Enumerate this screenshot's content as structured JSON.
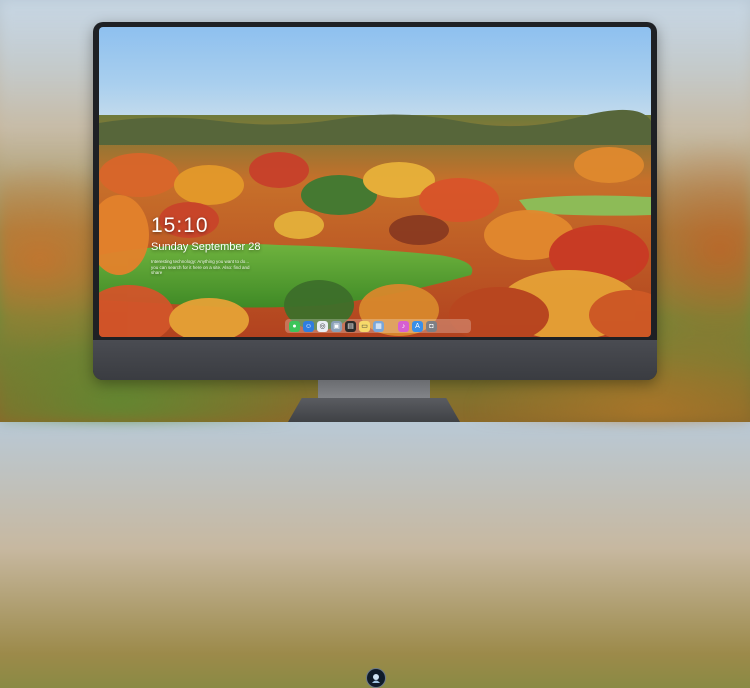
{
  "lock_screen": {
    "time": "15:10",
    "date": "Sunday September 28",
    "note": "Interesting technology: Anything you want to do... you can search for it here on a site. Also: find and share"
  },
  "dock": {
    "apps": [
      {
        "name": "messages-icon",
        "color": "#3cc45a",
        "glyph": "●"
      },
      {
        "name": "finder-icon",
        "color": "#2f7de0",
        "glyph": "☺"
      },
      {
        "name": "safari-icon",
        "color": "#e9eef5",
        "glyph": "◎"
      },
      {
        "name": "preview-icon",
        "color": "#8aa0b8",
        "glyph": "▣"
      },
      {
        "name": "final-cut-icon",
        "color": "#2a2a2a",
        "glyph": "▤"
      },
      {
        "name": "notes-icon",
        "color": "#f6d96a",
        "glyph": "▭"
      },
      {
        "name": "photos-icon",
        "color": "#7aa6d8",
        "glyph": "▦"
      },
      {
        "name": "itunes-icon",
        "color": "#d65fd2",
        "glyph": "♪"
      },
      {
        "name": "app-store-icon",
        "color": "#3a8fe8",
        "glyph": "A"
      },
      {
        "name": "screenshot-icon",
        "color": "#7d7f85",
        "glyph": "◘"
      }
    ]
  },
  "accent_colors": {
    "bezel": "#1e2024",
    "chin": "#45474c",
    "sky": "#8ec0ef",
    "meadow": "#4f9a2d"
  }
}
